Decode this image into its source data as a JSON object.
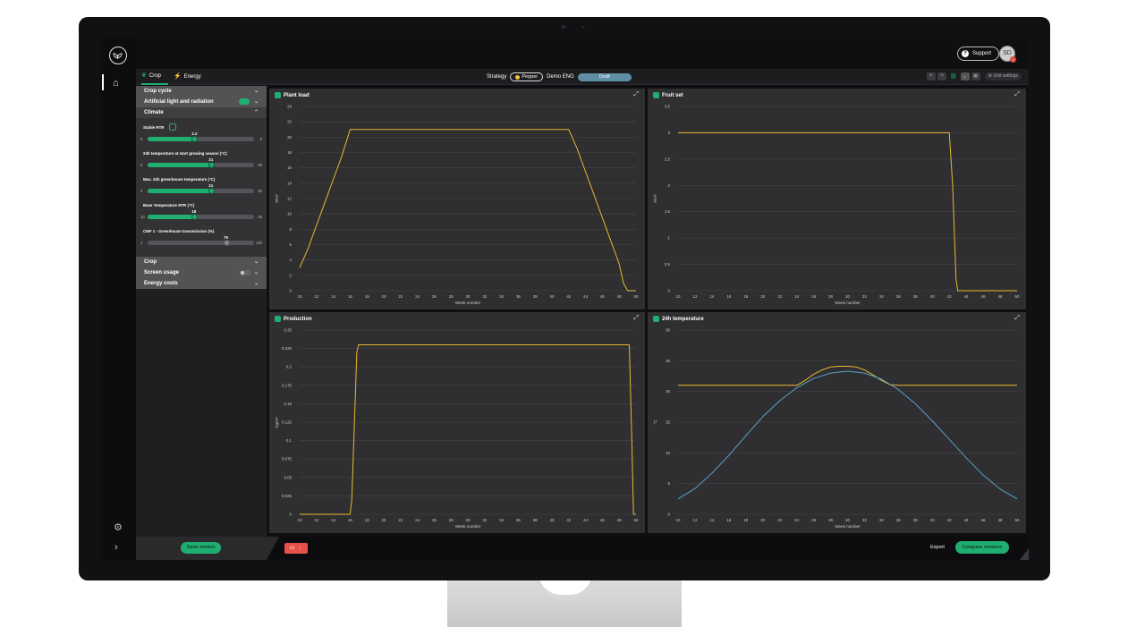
{
  "header": {
    "support_label": "Support",
    "avatar_initials": "SD",
    "notification_count": "1"
  },
  "tabs": [
    {
      "label": "Crop",
      "icon": "leaf-icon"
    },
    {
      "label": "Energy",
      "icon": "lightning-icon"
    }
  ],
  "strategy": {
    "label": "Strategy",
    "crop": "Pepper",
    "name": "Demo ENG",
    "status": "Draft"
  },
  "toolbar": {
    "unit_settings_label": "Unit settings"
  },
  "sidebar": {
    "sections_top": [
      {
        "label": "Crop cycle"
      },
      {
        "label": "Artificial light and radiation"
      },
      {
        "label": "Climate"
      }
    ],
    "controls": [
      {
        "label": "Stable RTR",
        "value": "2.2",
        "min": "0",
        "max": "5",
        "fraction": 0.44
      },
      {
        "label": "24h temperature at start growing season (°C)",
        "value": "21",
        "min": "0",
        "max": "30",
        "fraction": 0.6
      },
      {
        "label": "Max. 24h greenhouse temperature (°C)",
        "value": "21",
        "min": "0",
        "max": "30",
        "fraction": 0.6
      },
      {
        "label": "Base Temperature RTR (°C)",
        "value": "18",
        "min": "10",
        "max": "25",
        "fraction": 0.44
      },
      {
        "label": "CMF 1 - Greenhouse transmission (%)",
        "value": "75",
        "min": "1",
        "max": "100",
        "fraction": 0.74
      }
    ],
    "sections_bottom": [
      {
        "label": "Crop"
      },
      {
        "label": "Screen usage"
      },
      {
        "label": "Energy costs"
      }
    ]
  },
  "footer": {
    "save_label": "Save version",
    "version_label": "v1",
    "version_menu": "⋮",
    "export_label": "Export",
    "compare_label": "Compare versions"
  },
  "colors": {
    "accent": "#1fae6f",
    "series_yellow": "#e8b830",
    "series_blue": "#5a9fc4"
  },
  "chart_data": [
    {
      "type": "line",
      "title": "Plant load",
      "xlabel": "Week number",
      "ylabel": "#/m²",
      "xlim": [
        10,
        50
      ],
      "ylim": [
        0,
        24
      ],
      "xticks": [
        10,
        12,
        14,
        16,
        18,
        20,
        22,
        24,
        26,
        28,
        30,
        32,
        34,
        36,
        38,
        40,
        42,
        44,
        46,
        48,
        50
      ],
      "yticks": [
        0,
        2,
        4,
        6,
        8,
        10,
        12,
        14,
        16,
        18,
        20,
        22,
        24
      ],
      "series": [
        {
          "color": "yellow",
          "x": [
            10,
            11,
            12,
            13,
            14,
            15,
            16,
            17,
            18,
            20,
            22,
            24,
            26,
            28,
            30,
            32,
            34,
            36,
            38,
            40,
            42,
            43,
            44,
            45,
            46,
            47,
            48,
            48.5,
            49,
            50
          ],
          "y": [
            3,
            5.5,
            8.5,
            11.5,
            14.5,
            17.5,
            21,
            21,
            21,
            21,
            21,
            21,
            21,
            21,
            21,
            21,
            21,
            21,
            21,
            21,
            21,
            18.5,
            15.5,
            12.5,
            9.5,
            6.5,
            3.5,
            1,
            0,
            0
          ]
        }
      ]
    },
    {
      "type": "line",
      "title": "Fruit set",
      "xlabel": "Week number",
      "ylabel": "#/m²",
      "xlim": [
        10,
        50
      ],
      "ylim": [
        0,
        3.5
      ],
      "xticks": [
        10,
        12,
        14,
        16,
        18,
        20,
        22,
        24,
        26,
        28,
        30,
        32,
        34,
        36,
        38,
        40,
        42,
        44,
        46,
        48,
        50
      ],
      "yticks": [
        0,
        0.5,
        1,
        1.5,
        2,
        2.5,
        3,
        3.5
      ],
      "series": [
        {
          "color": "yellow",
          "x": [
            10,
            20,
            30,
            40,
            42,
            42.4,
            42.8,
            43,
            50
          ],
          "y": [
            3,
            3,
            3,
            3,
            3,
            2,
            0.2,
            0,
            0
          ]
        }
      ]
    },
    {
      "type": "line",
      "title": "Production",
      "xlabel": "Week number",
      "ylabel": "kg/m²",
      "xlim": [
        10,
        50
      ],
      "ylim": [
        0,
        0.25
      ],
      "xticks": [
        10,
        12,
        14,
        16,
        18,
        20,
        22,
        24,
        26,
        28,
        30,
        32,
        34,
        36,
        38,
        40,
        42,
        44,
        46,
        48,
        50
      ],
      "yticks": [
        0,
        0.025,
        0.05,
        0.075,
        0.1,
        0.125,
        0.15,
        0.175,
        0.2,
        0.225,
        0.25
      ],
      "series": [
        {
          "color": "yellow",
          "x": [
            10,
            15,
            16,
            16.2,
            16.5,
            16.8,
            17,
            20,
            30,
            40,
            48,
            49.2,
            49.5,
            49.7,
            50
          ],
          "y": [
            0,
            0,
            0,
            0.02,
            0.12,
            0.22,
            0.23,
            0.23,
            0.23,
            0.23,
            0.23,
            0.23,
            0.1,
            0,
            0
          ]
        }
      ]
    },
    {
      "type": "line",
      "title": "24h temperature",
      "xlabel": "Week number",
      "ylabel": "°C",
      "xlim": [
        10,
        50
      ],
      "ylim": [
        0,
        30
      ],
      "xticks": [
        10,
        12,
        14,
        16,
        18,
        20,
        22,
        24,
        26,
        28,
        30,
        32,
        34,
        36,
        38,
        40,
        42,
        44,
        46,
        48,
        50
      ],
      "yticks": [
        0,
        5,
        10,
        15,
        20,
        25,
        30
      ],
      "series": [
        {
          "color": "yellow",
          "x": [
            10,
            14,
            18,
            22,
            24,
            25,
            26,
            27,
            28,
            29,
            30,
            31,
            32,
            33,
            34,
            35,
            36,
            38,
            42,
            46,
            50
          ],
          "y": [
            21,
            21,
            21,
            21,
            21,
            21.8,
            22.8,
            23.5,
            24,
            24.1,
            24.1,
            24,
            23.5,
            22.7,
            21.8,
            21.1,
            21,
            21,
            21,
            21,
            21
          ]
        },
        {
          "color": "blue",
          "x": [
            10,
            12,
            14,
            16,
            18,
            20,
            22,
            24,
            26,
            28,
            30,
            32,
            34,
            36,
            38,
            40,
            42,
            44,
            46,
            48,
            50
          ],
          "y": [
            2.5,
            4.2,
            6.7,
            9.6,
            12.8,
            15.9,
            18.5,
            20.6,
            22.1,
            23,
            23.3,
            23,
            22,
            20.3,
            18,
            15.2,
            12.2,
            9.2,
            6.4,
            4.1,
            2.5
          ]
        }
      ]
    }
  ]
}
